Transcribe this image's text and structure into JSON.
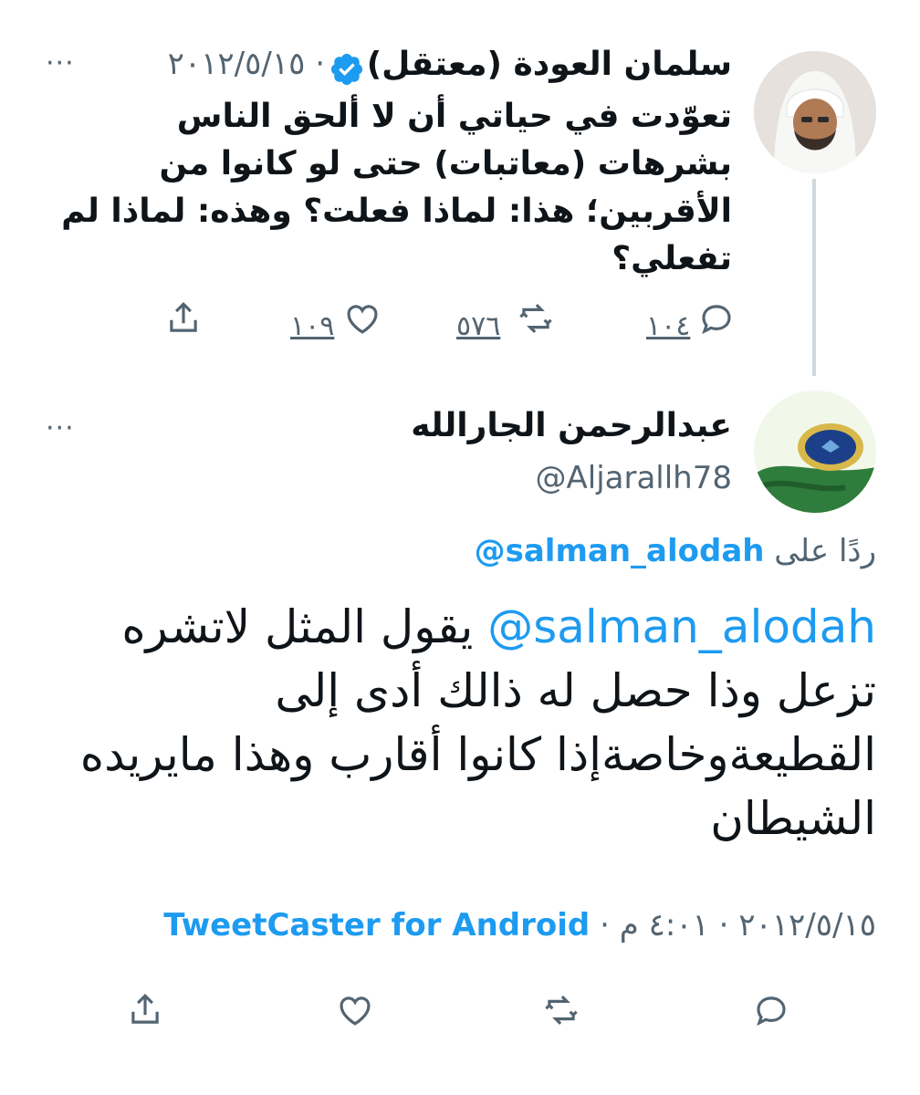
{
  "parent_tweet": {
    "author_name": "سلمان العودة (معتقل)",
    "date": "٢٠١٢/٥/١٥",
    "separator": "·",
    "more_glyph": "···",
    "text": "تعوّدت في حياتي أن لا  ألحق الناس بشرهات (معاتبات) حتى لو كانوا من الأقربين؛ هذا: لماذا فعلت؟ وهذه: لماذا لم تفعلي؟",
    "replies": "١٠٤",
    "retweets": "٥٧٦",
    "likes": "١٠٩"
  },
  "reply_tweet": {
    "author_name": "عبدالرحمن الجارالله",
    "handle": "@Aljarallh78",
    "more_glyph": "···",
    "reply_prefix": "ردًا على",
    "reply_to": "@salman_alodah",
    "mention": "@salman_alodah",
    "text": "يقول المثل لاتشره تزعل وذا حصل له ذالك أدى إلى القطيعةوخاصةإذا كانوا أقارب وهذا مايريده الشيطان",
    "date": "٢٠١٢/٥/١٥",
    "dot1": "·",
    "time": "٤:٠١ م",
    "dot2": "·",
    "source": "TweetCaster for Android"
  },
  "colors": {
    "accent": "#1d9bf0",
    "muted": "#536471",
    "text": "#0f1419",
    "line": "#cfd9de"
  },
  "icons": [
    "share-icon",
    "like-icon",
    "retweet-icon",
    "reply-icon",
    "verified-icon",
    "more-icon"
  ]
}
